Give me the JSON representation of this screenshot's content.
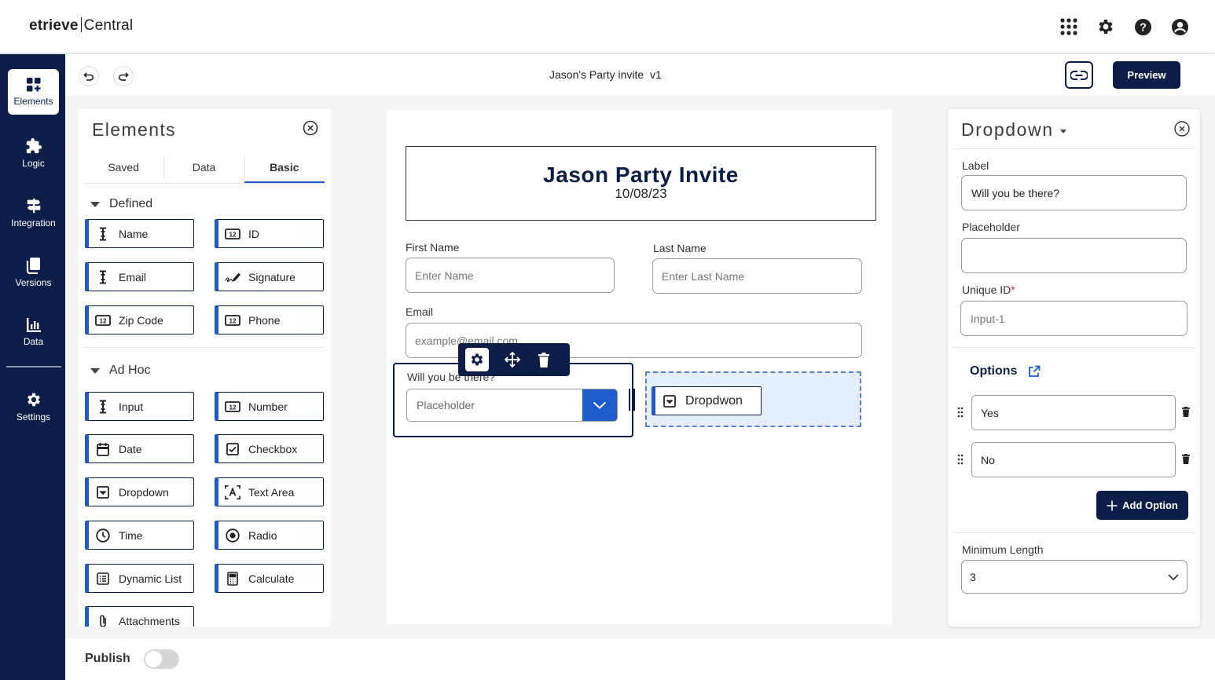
{
  "header": {
    "brand_left": "etrieve",
    "brand_right": "Central",
    "icons": [
      "apps-grid-icon",
      "gear-icon",
      "help-icon",
      "account-icon"
    ]
  },
  "leftnav": {
    "items": [
      {
        "label": "Elements",
        "icon": "elements-icon",
        "active": true
      },
      {
        "label": "Logic",
        "icon": "puzzle-icon"
      },
      {
        "label": "Integration",
        "icon": "signpost-icon"
      },
      {
        "label": "Versions",
        "icon": "copy-icon"
      },
      {
        "label": "Data",
        "icon": "chart-icon"
      },
      {
        "label": "Settings",
        "icon": "gear-icon"
      }
    ]
  },
  "toolbar": {
    "doc_title": "Jason's Party invite  v1",
    "preview_label": "Preview"
  },
  "elements_panel": {
    "title": "Elements",
    "tabs": [
      "Saved",
      "Data",
      "Basic"
    ],
    "active_tab": "Basic",
    "sections": {
      "defined": {
        "title": "Defined",
        "items": [
          {
            "label": "Name",
            "icon": "text-cursor-icon"
          },
          {
            "label": "ID",
            "icon": "number-field-icon"
          },
          {
            "label": "Email",
            "icon": "text-cursor-icon"
          },
          {
            "label": "Signature",
            "icon": "signature-icon"
          },
          {
            "label": "Zip Code",
            "icon": "number-field-icon"
          },
          {
            "label": "Phone",
            "icon": "number-field-icon"
          }
        ]
      },
      "adhoc": {
        "title": "Ad Hoc",
        "items": [
          {
            "label": "Input",
            "icon": "text-cursor-icon"
          },
          {
            "label": "Number",
            "icon": "number-field-icon"
          },
          {
            "label": "Date",
            "icon": "calendar-icon"
          },
          {
            "label": "Checkbox",
            "icon": "checkbox-icon"
          },
          {
            "label": "Dropdown",
            "icon": "dropdown-icon"
          },
          {
            "label": "Text Area",
            "icon": "text-area-icon"
          },
          {
            "label": "Time",
            "icon": "clock-icon"
          },
          {
            "label": "Radio",
            "icon": "radio-icon"
          },
          {
            "label": "Dynamic List",
            "icon": "list-icon"
          },
          {
            "label": "Calculate",
            "icon": "calculator-icon"
          },
          {
            "label": "Attachments",
            "icon": "attachment-icon"
          }
        ]
      }
    }
  },
  "canvas": {
    "form_title": "Jason Party Invite",
    "form_date": "10/08/23",
    "first_name_label": "First Name",
    "first_name_placeholder": "Enter Name",
    "last_name_label": "Last Name",
    "last_name_placeholder": "Enter Last Name",
    "email_label": "Email",
    "email_placeholder": "example@email.com",
    "dropdown_label": "Will you be there?",
    "dropdown_placeholder": "Placeholder",
    "dropped_chip_label": "Dropdwon"
  },
  "properties": {
    "title": "Dropdown",
    "label_label": "Label",
    "label_value": "Will you be there?",
    "placeholder_label": "Placeholder",
    "placeholder_value": "",
    "unique_id_label": "Unique ID",
    "unique_id_required": "*",
    "unique_id_placeholder": "Input-1",
    "options_label": "Options",
    "options": [
      "Yes",
      "No"
    ],
    "add_option_label": "Add Option",
    "min_length_label": "Minimum Length",
    "min_length_value": "3"
  },
  "bottom": {
    "publish_label": "Publish",
    "publish_on": false
  },
  "colors": {
    "navy": "#0c1e47",
    "accent_blue": "#1c5bc9",
    "drop_zone_bg": "#e5eefb"
  }
}
